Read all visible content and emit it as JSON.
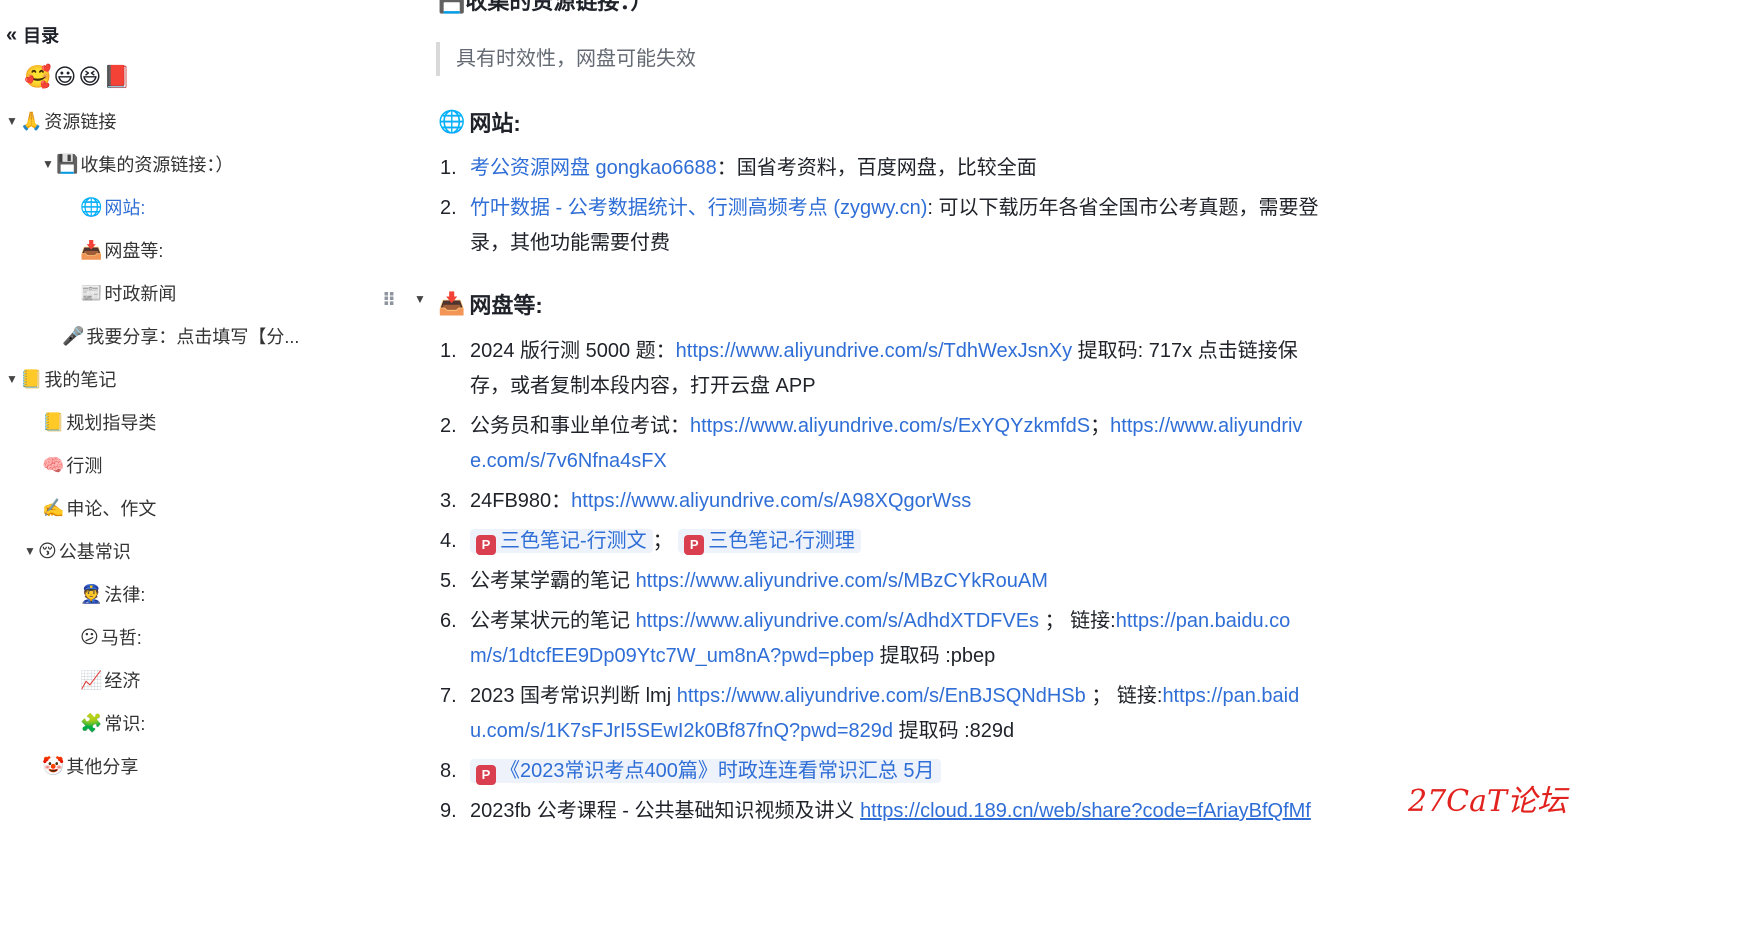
{
  "sidebar": {
    "title": "目录",
    "emoji_row": "🥰😃😆📕",
    "items": [
      {
        "icon": "🙏",
        "label": "资源链接"
      },
      {
        "icon": "💾",
        "label": "收集的资源链接：）"
      },
      {
        "icon": "🌐",
        "label": "网站:"
      },
      {
        "icon": "📥",
        "label": "网盘等:"
      },
      {
        "icon": "📰",
        "label": "时政新闻"
      },
      {
        "icon": "🎤",
        "label": "我要分享：点击填写【分..."
      },
      {
        "icon": "📒",
        "label": "我的笔记"
      },
      {
        "icon": "📒",
        "label": "规划指导类"
      },
      {
        "icon": "🧠",
        "label": "行测"
      },
      {
        "icon": "✍️",
        "label": "申论、作文"
      },
      {
        "icon": "😚",
        "label": "公基常识"
      },
      {
        "icon": "👮",
        "label": "法律:"
      },
      {
        "icon": "😕",
        "label": "马哲:"
      },
      {
        "icon": "📈",
        "label": "经济"
      },
      {
        "icon": "🧩",
        "label": "常识:"
      },
      {
        "icon": "🤡",
        "label": "其他分享"
      }
    ]
  },
  "main": {
    "top_heading": "收集的资源链接：）",
    "top_heading_icon": "💾",
    "quote": "具有时效性，网盘可能失效",
    "websites": {
      "icon": "🌐",
      "title": "网站:",
      "items": [
        {
          "num": "1.",
          "link": "考公资源网盘 gongkao6688",
          "text": "：国省考资料，百度网盘，比较全面"
        },
        {
          "num": "2.",
          "link": "竹叶数据 - 公考数据统计、行测高频考点 (zygwy.cn)",
          "text": ": 可以下载历年各省全国市公考真题，需要登",
          "text2": "录，其他功能需要付费"
        }
      ]
    },
    "netdisk": {
      "icon": "📥",
      "title": "网盘等:",
      "items": [
        {
          "num": "1.",
          "prefix": "2024 版行测 5000 题：",
          "link": "https://www.aliyundrive.com/s/TdhWexJsnXy",
          "suffix": " 提取码: 717x 点击链接保",
          "line2": "存，或者复制本段内容，打开云盘 APP"
        },
        {
          "num": "2.",
          "prefix": "公务员和事业单位考试：",
          "link": "https://www.aliyundrive.com/s/ExYQYzkmfdS",
          "mid": "；",
          "link2": "https://www.aliyundriv",
          "line2_link": "e.com/s/7v6Nfna4sFX"
        },
        {
          "num": "3.",
          "prefix": "24FB980：",
          "link": "https://www.aliyundrive.com/s/A98XQgorWss"
        },
        {
          "num": "4.",
          "chip1": "三色笔记-行测文",
          "sep": "；",
          "chip2": "三色笔记-行测理"
        },
        {
          "num": "5.",
          "prefix": "公考某学霸的笔记 ",
          "link": "https://www.aliyundrive.com/s/MBzCYkRouAM"
        },
        {
          "num": "6.",
          "prefix": "公考某状元的笔记 ",
          "link": "https://www.aliyundrive.com/s/AdhdXTDFVEs",
          "mid": " ； 链接:",
          "link2": "https://pan.baidu.co",
          "line2_link": "m/s/1dtcfEE9Dp09Ytc7W_um8nA?pwd=pbep",
          "line2_text": " 提取码 :pbep"
        },
        {
          "num": "7.",
          "prefix": "2023 国考常识判断 lmj ",
          "link": "https://www.aliyundrive.com/s/EnBJSQNdHSb",
          "mid": " ； 链接:",
          "link2": "https://pan.baid",
          "line2_link": "u.com/s/1K7sFJrI5SEwI2k0Bf87fnQ?pwd=829d",
          "line2_text": " 提取码 :829d"
        },
        {
          "num": "8.",
          "chip1": "《2023常识考点400篇》时政连连看常识汇总 5月"
        },
        {
          "num": "9.",
          "prefix": "2023fb 公考课程 - 公共基础知识视频及讲义 ",
          "link": "https://cloud.189.cn/web/share?code=fAriayBfQfMf"
        }
      ]
    }
  },
  "watermark": "27CaT论坛",
  "colors": {
    "link": "#2f6ed6",
    "doc_icon": "#d93f4f",
    "watermark": "#e2221f"
  }
}
